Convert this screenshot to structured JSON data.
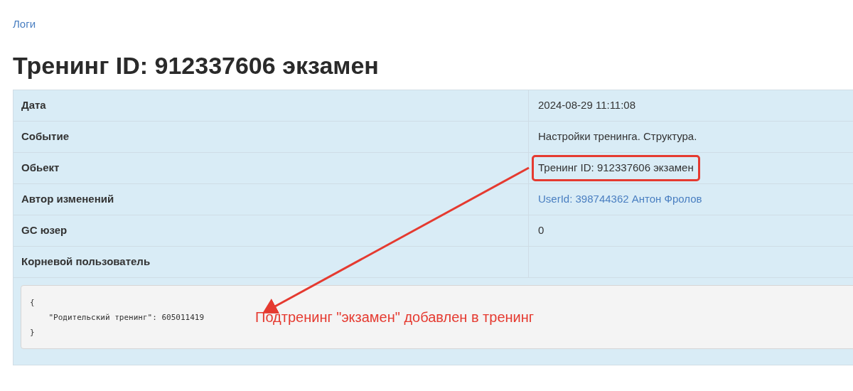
{
  "breadcrumb": "Логи",
  "title": "Тренинг ID: 912337606 экзамен",
  "rows": [
    {
      "label": "Дата",
      "value": "2024-08-29 11:11:08",
      "kind": "text",
      "highlighted": false
    },
    {
      "label": "Событие",
      "value": "Настройки тренинга. Структура.",
      "kind": "text",
      "highlighted": false
    },
    {
      "label": "Обьект",
      "value": "Тренинг ID: 912337606 экзамен",
      "kind": "text",
      "highlighted": true
    },
    {
      "label": "Автор изменений",
      "value": "UserId: 398744362 Антон Фролов",
      "kind": "link",
      "highlighted": false
    },
    {
      "label": "GC юзер",
      "value": "0",
      "kind": "text",
      "highlighted": false
    },
    {
      "label": "Корневой пользователь",
      "highlighted": false
    }
  ],
  "code_lines": [
    "{",
    "    \"Родительский тренинг\": 605011419",
    "}"
  ],
  "annotation": "Подтренинг \"экзамен\" добавлен в тренинг"
}
